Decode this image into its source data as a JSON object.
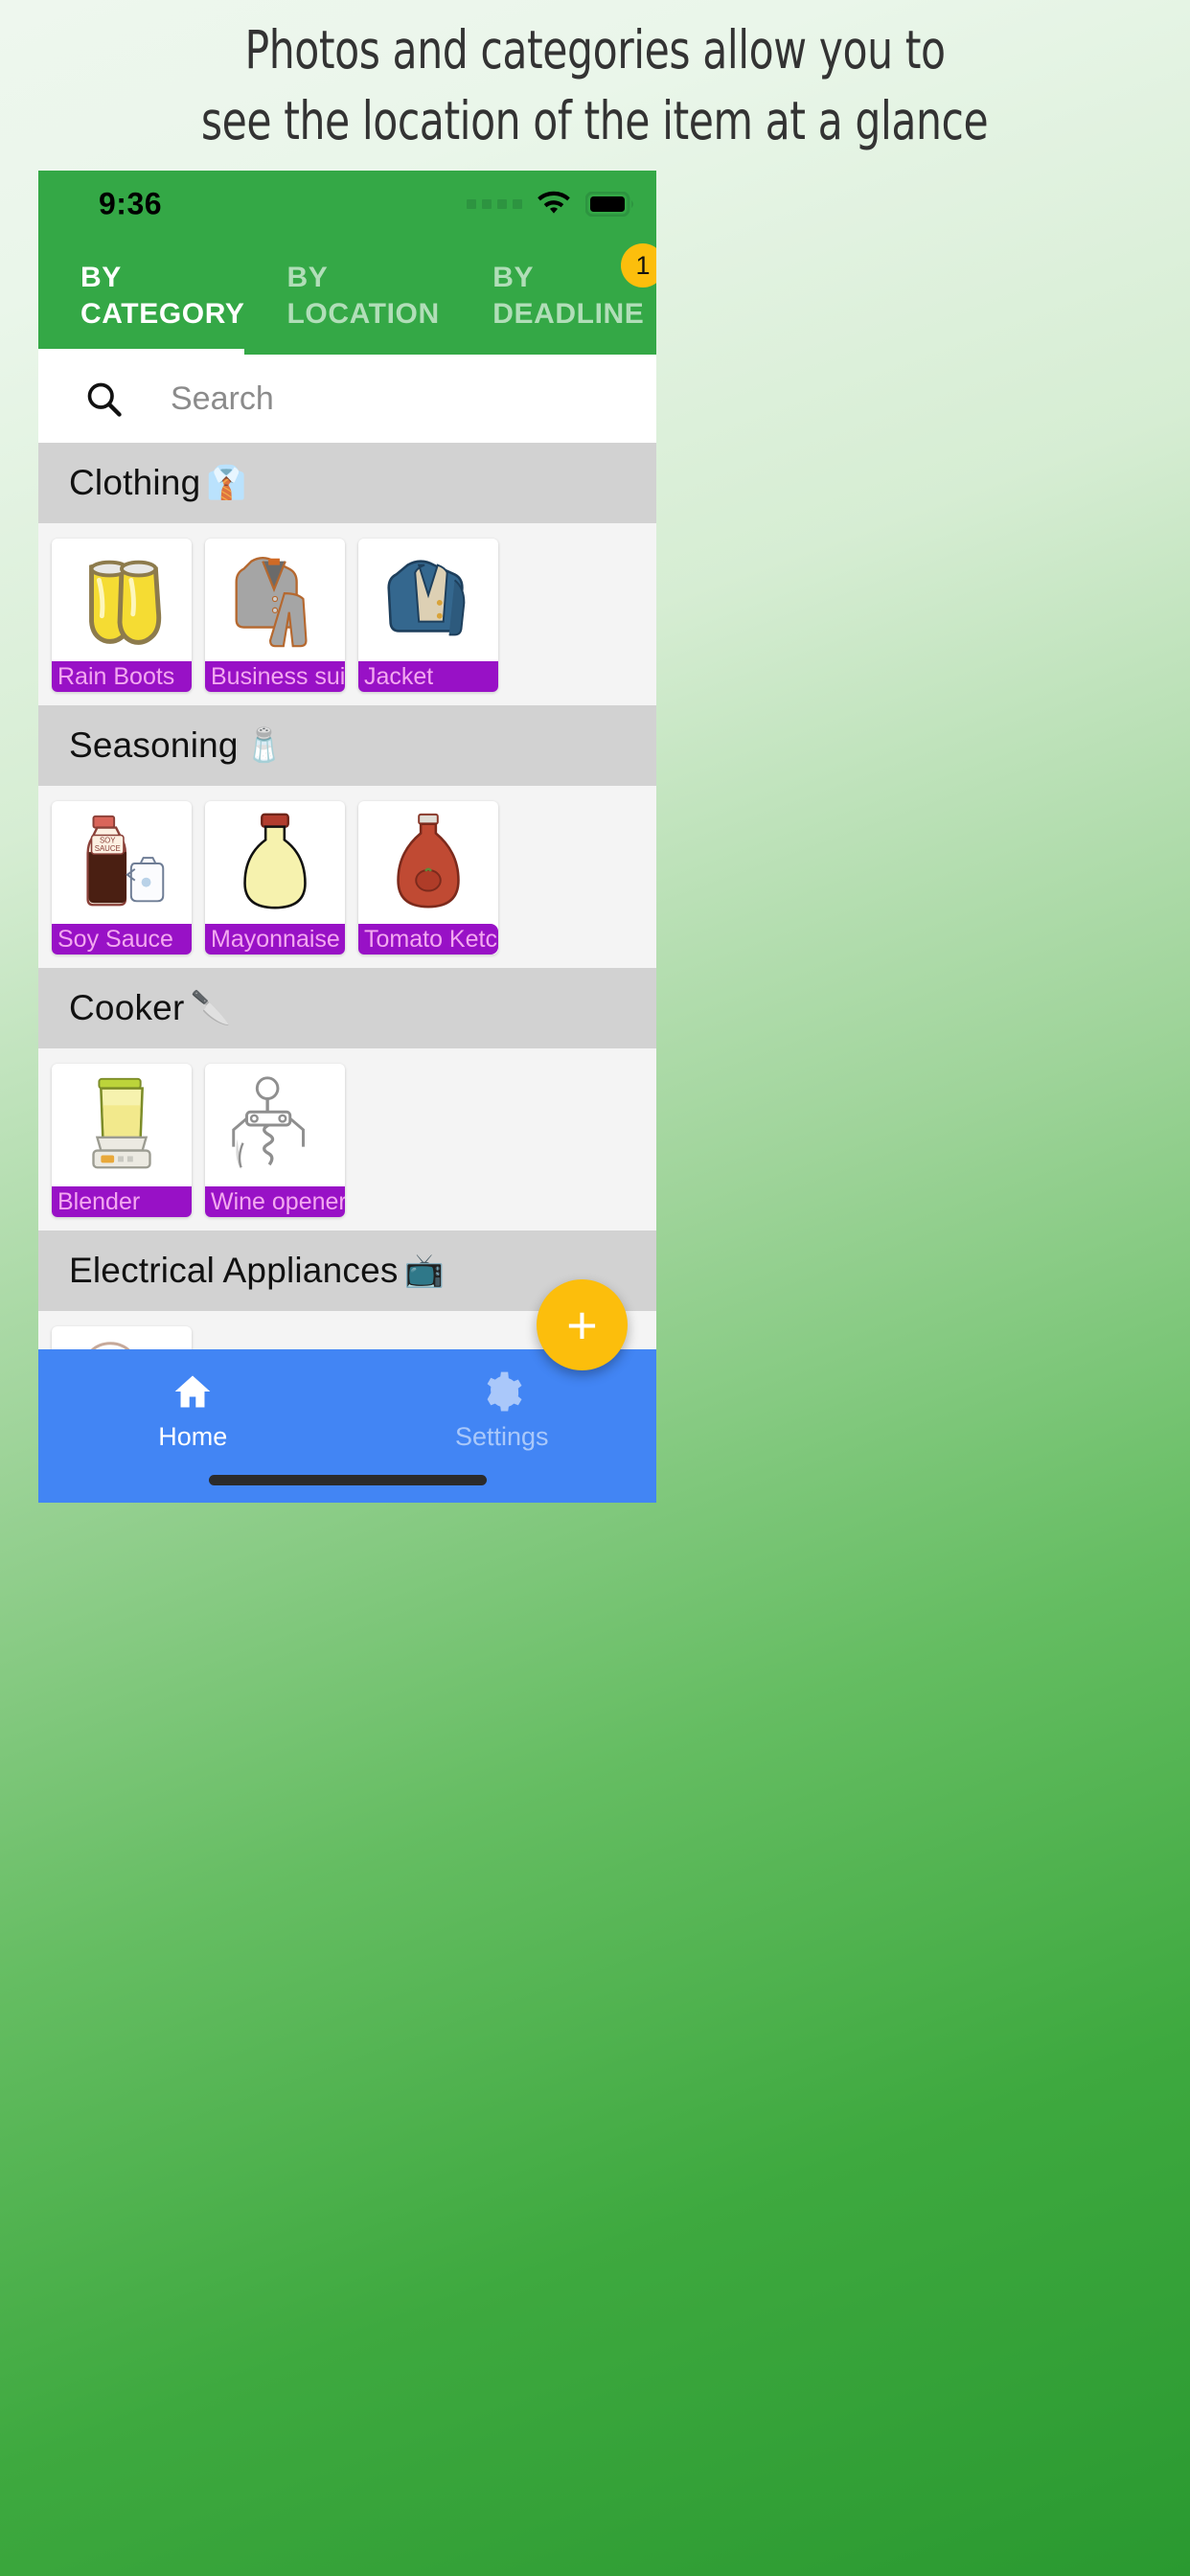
{
  "headline": {
    "line1": "Photos and categories allow you to",
    "line2": "see the location of the item at a glance"
  },
  "colors": {
    "app_bar_green": "#34a846",
    "badge_amber": "#FCBE0C",
    "label_purple": "#9811C6",
    "label_text": "#F3A8F0",
    "bottom_nav_blue": "#4285F4",
    "section_gray": "#d2d2d2"
  },
  "status_bar": {
    "time": "9:36",
    "signal_icon": "signal-dots-icon",
    "wifi_icon": "wifi-icon",
    "battery_icon": "battery-full-icon"
  },
  "tabs": [
    {
      "line1": "BY",
      "line2": "CATEGORY",
      "active": true
    },
    {
      "line1": "BY",
      "line2": "LOCATION",
      "active": false
    },
    {
      "line1": "BY",
      "line2": "DEADLINE",
      "active": false
    }
  ],
  "tab_badge": {
    "count": "1"
  },
  "search": {
    "placeholder": "Search",
    "icon": "search-icon"
  },
  "sections": [
    {
      "title": "Clothing",
      "emoji": "👔",
      "emoji_name": "necktie-emoji",
      "items": [
        {
          "label": "Rain Boots",
          "art": "rain-boots"
        },
        {
          "label": "Business suit",
          "art": "business-suit"
        },
        {
          "label": "Jacket",
          "art": "jacket"
        }
      ]
    },
    {
      "title": "Seasoning",
      "emoji": "🧂",
      "emoji_name": "salt-shaker-emoji",
      "items": [
        {
          "label": "Soy  Sauce",
          "art": "soy-sauce"
        },
        {
          "label": "Mayonnaise",
          "art": "mayonnaise"
        },
        {
          "label": "Tomato  Ketch",
          "art": "ketchup"
        }
      ]
    },
    {
      "title": "Cooker",
      "emoji": "🔪",
      "emoji_name": "kitchen-knife-emoji",
      "items": [
        {
          "label": "Blender",
          "art": "blender"
        },
        {
          "label": "Wine opener",
          "art": "corkscrew"
        }
      ]
    },
    {
      "title": "Electrical Appliances",
      "emoji": "📺",
      "emoji_name": "television-emoji",
      "items": [
        {
          "label": "",
          "art": "electric-fan"
        }
      ]
    }
  ],
  "fab": {
    "label": "+",
    "icon": "plus-icon"
  },
  "bottom_nav": [
    {
      "label": "Home",
      "icon": "home-icon",
      "active": true
    },
    {
      "label": "Settings",
      "icon": "gear-icon",
      "active": false
    }
  ]
}
